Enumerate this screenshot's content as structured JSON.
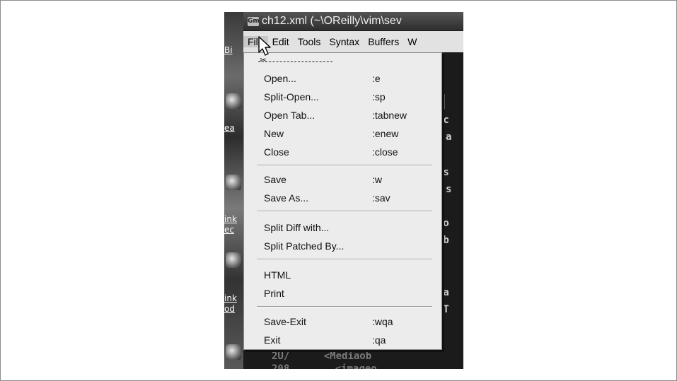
{
  "window": {
    "title": "ch12.xml (~\\OReilly\\vim\\sev",
    "app_icon": "gvim-icon"
  },
  "desktop": {
    "labels": [
      "Bi",
      "ea",
      "ink",
      "ec",
      "ink",
      "od"
    ]
  },
  "menubar": {
    "items": [
      "File",
      "Edit",
      "Tools",
      "Syntax",
      "Buffers",
      "W"
    ]
  },
  "file_menu": {
    "tearoff": "- - - - - - - -",
    "groups": [
      [
        {
          "label": "Open...",
          "shortcut": ":e"
        },
        {
          "label": "Split-Open...",
          "shortcut": ":sp"
        },
        {
          "label": "Open Tab...",
          "shortcut": ":tabnew"
        },
        {
          "label": "New",
          "shortcut": ":enew"
        },
        {
          "label": "Close",
          "shortcut": ":close"
        }
      ],
      [
        {
          "label": "Save",
          "shortcut": ":w"
        },
        {
          "label": "Save As...",
          "shortcut": ":sav"
        }
      ],
      [
        {
          "label": "Split Diff with...",
          "shortcut": ""
        },
        {
          "label": "Split Patched By...",
          "shortcut": ""
        }
      ],
      [
        {
          "label": "HTML",
          "shortcut": ""
        },
        {
          "label": "Print",
          "shortcut": ""
        }
      ],
      [
        {
          "label": "Save-Exit",
          "shortcut": ":wqa"
        },
        {
          "label": "Exit",
          "shortcut": ":qa"
        }
      ]
    ]
  },
  "editor": {
    "visible_fragments": [
      "<c",
      "a",
      "ns",
      "s",
      "a",
      "go",
      "ab",
      "s",
      "la",
      ">T"
    ],
    "bottom_lines": [
      "2U/",
      "<Mediaob",
      "208",
      "<imageo"
    ]
  }
}
